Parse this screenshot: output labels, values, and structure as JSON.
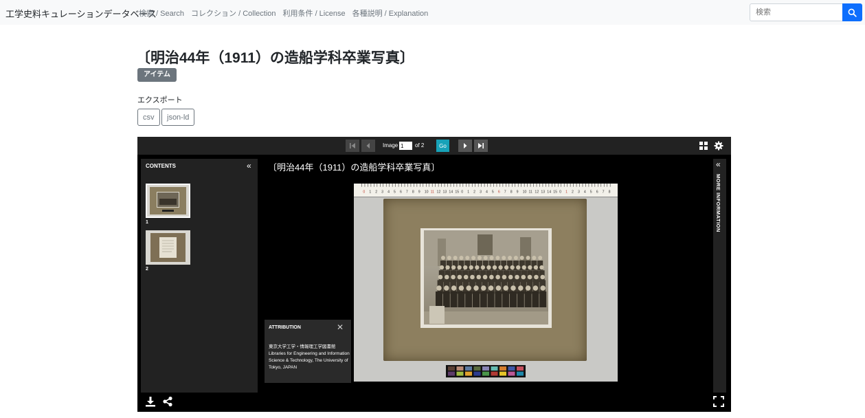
{
  "navbar": {
    "brand": "工学史料キュレーションデータベース",
    "links": [
      "検索 / Search",
      "コレクション / Collection",
      "利用条件 / License",
      "各種説明 / Explanation"
    ],
    "search_placeholder": "検索",
    "search_icon": "search-icon",
    "accent_color": "#0d6efd"
  },
  "item": {
    "title": "〔明治44年（1911）の造船学科卒業写真〕",
    "badge": "アイテム",
    "export_label": "エクスポート",
    "export_buttons": [
      "csv",
      "json-ld"
    ]
  },
  "viewer": {
    "image_label": "Image",
    "current_page": "1",
    "of_label": "of 2",
    "go_label": "Go",
    "contents_label": "CONTENTS",
    "canvas_title": "〔明治44年（1911）の造船学科卒業写真〕",
    "thumbnails": [
      {
        "number": "1"
      },
      {
        "number": "2"
      }
    ],
    "more_information_label": "MORE INFORMATION",
    "attribution": {
      "title": "ATTRIBUTION",
      "text": "東京大学工学・情報理工学図書館 Libraries for Engineering and Information Science & Technology, The University of Tokyo, JAPAN"
    },
    "go_color": "#17a2b8",
    "ruler_numbers": [
      "0",
      "1",
      "2",
      "3",
      "4",
      "5",
      "6",
      "7",
      "8",
      "9",
      "10",
      "11",
      "12",
      "13",
      "14",
      "15"
    ]
  }
}
